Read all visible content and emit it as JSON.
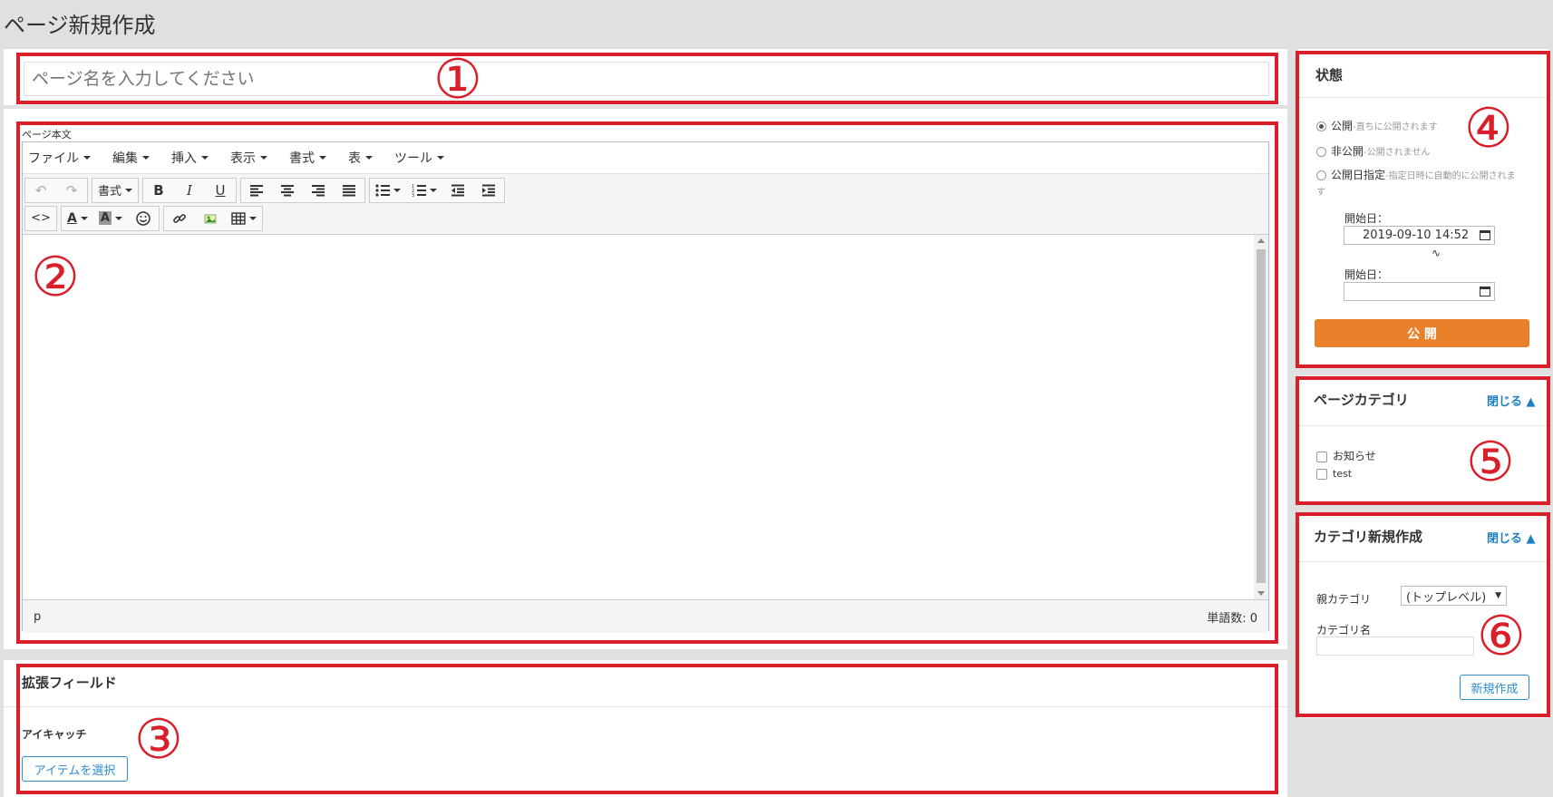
{
  "page_title": "ページ新規作成",
  "title_input": {
    "placeholder": "ページ名を入力してください"
  },
  "editor": {
    "label": "ページ本文",
    "menus": [
      "ファイル",
      "編集",
      "挿入",
      "表示",
      "書式",
      "表",
      "ツール"
    ],
    "format_dropdown": "書式",
    "status_path": "p",
    "word_count": "単語数: 0"
  },
  "extended_fields": {
    "title": "拡張フィールド",
    "eyecatch_label": "アイキャッチ",
    "select_button": "アイテムを選択"
  },
  "status_panel": {
    "title": "状態",
    "options": [
      {
        "label": "公開",
        "note": "-直ちに公開されます",
        "checked": true
      },
      {
        "label": "非公開",
        "note": "-公開されません",
        "checked": false
      },
      {
        "label": "公開日指定",
        "note": "-指定日時に自動的に公開されます",
        "checked": false
      }
    ],
    "start_label_1": "開始日：",
    "start_value_1": "2019-09-10 14:52",
    "range_sep": "∿",
    "start_label_2": "開始日：",
    "start_value_2": "",
    "publish_button": "公 開",
    "publish_color": "#e8812a"
  },
  "category_panel": {
    "title": "ページカテゴリ",
    "toggle": "閉じる ▲",
    "items": [
      "お知らせ",
      "test"
    ]
  },
  "new_category_panel": {
    "title": "カテゴリ新規作成",
    "toggle": "閉じる ▲",
    "parent_label": "親カテゴリ",
    "parent_value": "(トップレベル)",
    "name_label": "カテゴリ名",
    "name_value": "",
    "create_button": "新規作成"
  },
  "annotations": [
    "①",
    "②",
    "③",
    "④",
    "⑤",
    "⑥"
  ],
  "colors": {
    "annotation_red": "#d9202a",
    "link_blue": "#1e7fc3"
  }
}
